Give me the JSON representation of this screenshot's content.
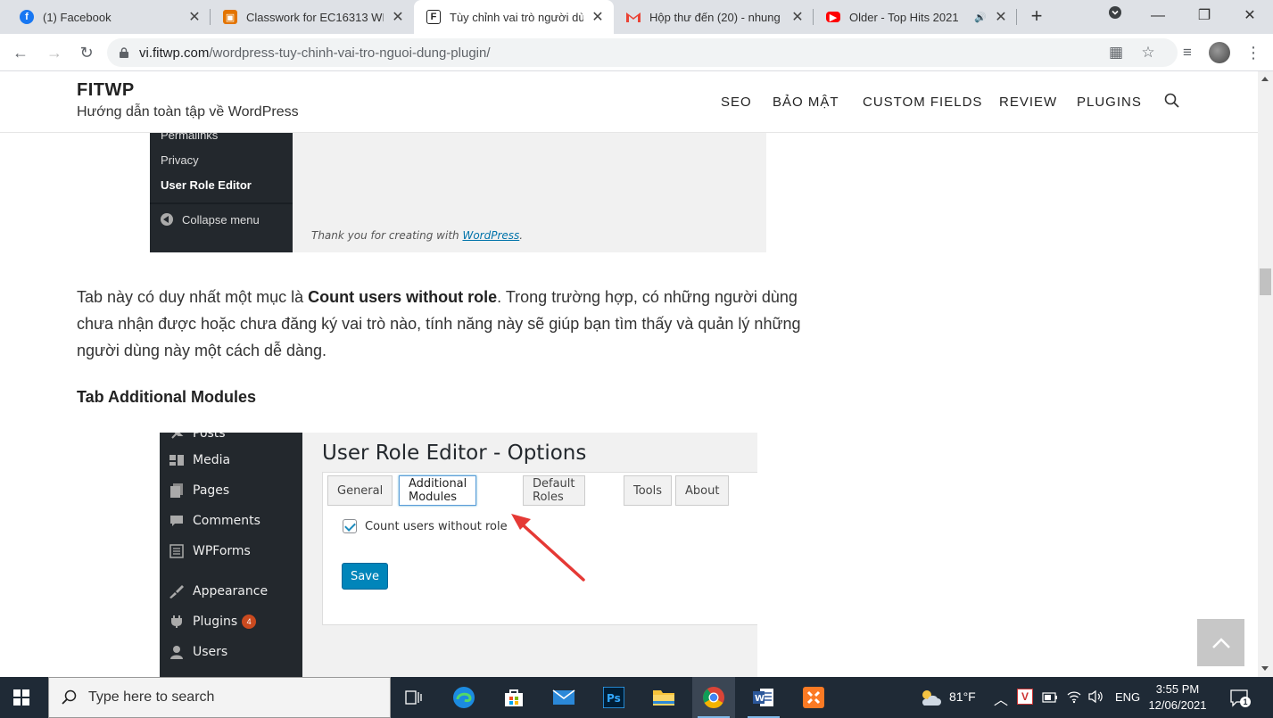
{
  "browser": {
    "tabs": [
      {
        "title": "(1) Facebook",
        "favicon": "facebook-icon",
        "color": "#1877f2"
      },
      {
        "title": "Classwork for EC16313 WE",
        "favicon": "classroom-icon",
        "color": "#e37400"
      },
      {
        "title": "Tùy chỉnh vai trò người dù",
        "favicon": "fitwp-icon",
        "color": "#222222",
        "active": true
      },
      {
        "title": "Hộp thư đến (20) - nhung",
        "favicon": "gmail-icon",
        "color": "#ea4335"
      },
      {
        "title": "Older - Top Hits 2021",
        "favicon": "youtube-icon",
        "color": "#ff0000",
        "audio": true
      }
    ],
    "url_host": "vi.fitwp.com",
    "url_path": "/wordpress-tuy-chinh-vai-tro-nguoi-dung-plugin/"
  },
  "site": {
    "brand": "FITWP",
    "tagline": "Hướng dẫn toàn tập về WordPress",
    "nav": [
      "SEO",
      "BẢO MẬT",
      "CUSTOM FIELDS",
      "REVIEW",
      "PLUGINS"
    ]
  },
  "shot1": {
    "items": [
      "Permalinks",
      "Privacy",
      "User Role Editor",
      "Collapse menu"
    ],
    "thanks_prefix": "Thank you for creating with ",
    "thanks_link": "WordPress",
    "thanks_suffix": "."
  },
  "article": {
    "para_before": "Tab này có duy nhất một mục là ",
    "para_bold": "Count users without role",
    "para_after": ". Trong trường hợp, có những người dùng chưa nhận được hoặc chưa đăng ký vai trò nào, tính năng này sẽ giúp bạn tìm thấy và quản lý những người dùng này một cách dễ dàng.",
    "heading": "Tab Additional Modules"
  },
  "shot2": {
    "title": "User Role Editor - Options",
    "tabs": [
      "General",
      "Additional Modules",
      "Default Roles",
      "Tools",
      "About"
    ],
    "active_tab": "Additional Modules",
    "menu": [
      "Posts",
      "Media",
      "Pages",
      "Comments",
      "WPForms",
      "Appearance",
      "Plugins",
      "Users"
    ],
    "plugins_badge": "4",
    "checkbox_label": "Count users without role",
    "checkbox_checked": true,
    "save_label": "Save"
  },
  "taskbar": {
    "search_placeholder": "Type here to search",
    "weather": "81°F",
    "lang": "ENG",
    "time": "3:55 PM",
    "date": "12/06/2021",
    "notifications": "1"
  }
}
